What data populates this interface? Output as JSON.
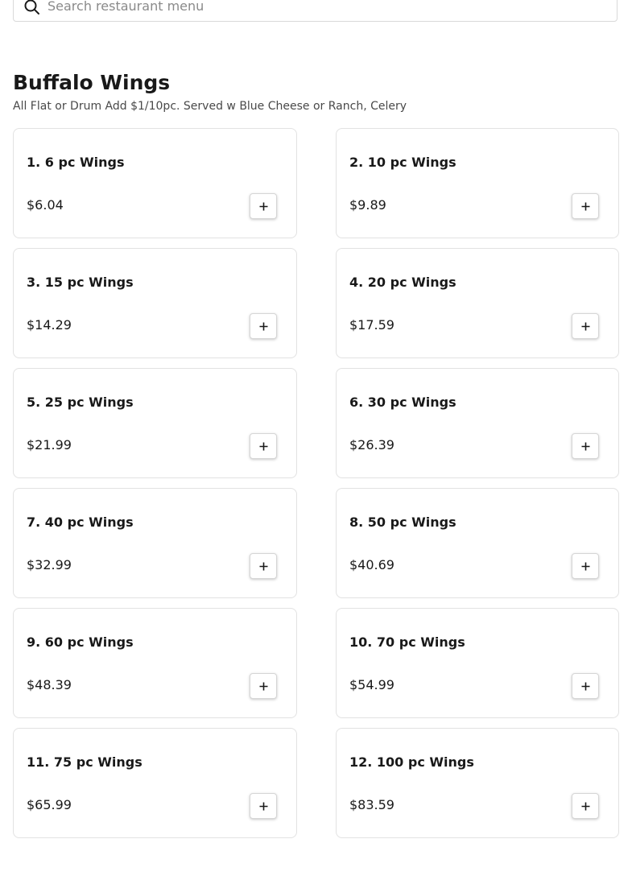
{
  "search": {
    "placeholder": "Search restaurant menu",
    "icon": "search-icon"
  },
  "section": {
    "title": "Buffalo Wings",
    "description": "All Flat or Drum Add $1/10pc. Served w Blue Cheese or Ranch, Celery"
  },
  "items": [
    {
      "name": "1. 6 pc Wings",
      "price": "$6.04"
    },
    {
      "name": "2. 10 pc Wings",
      "price": "$9.89"
    },
    {
      "name": "3. 15 pc Wings",
      "price": "$14.29"
    },
    {
      "name": "4. 20 pc Wings",
      "price": "$17.59"
    },
    {
      "name": "5. 25 pc Wings",
      "price": "$21.99"
    },
    {
      "name": "6. 30 pc Wings",
      "price": "$26.39"
    },
    {
      "name": "7. 40 pc Wings",
      "price": "$32.99"
    },
    {
      "name": "8. 50 pc Wings",
      "price": "$40.69"
    },
    {
      "name": "9. 60 pc Wings",
      "price": "$48.39"
    },
    {
      "name": "10. 70 pc Wings",
      "price": "$54.99"
    },
    {
      "name": "11. 75 pc Wings",
      "price": "$65.99"
    },
    {
      "name": "12. 100 pc Wings",
      "price": "$83.59"
    }
  ],
  "add_button_icon": "plus-icon",
  "colors": {
    "text": "#191919",
    "muted": "#494949",
    "border": "#e2e2e2",
    "background": "#ffffff"
  }
}
